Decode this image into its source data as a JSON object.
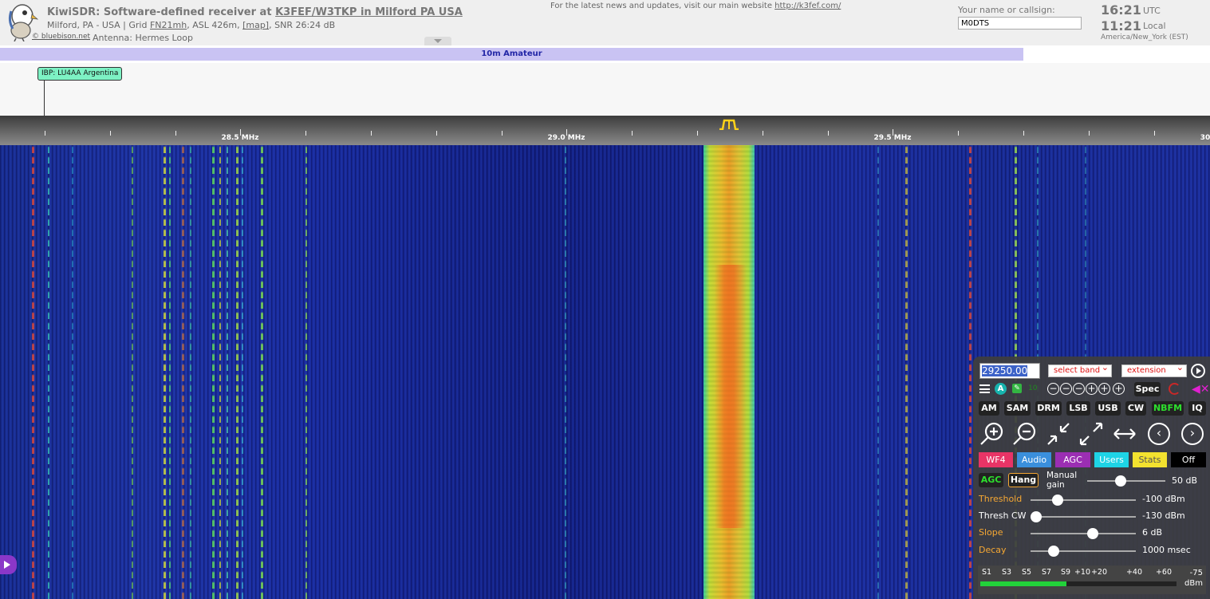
{
  "header": {
    "title_prefix": "KiwiSDR: Software-defined receiver at ",
    "title_station": "K3FEF/W3TKP in Milford PA USA",
    "location_text": "Milford, PA - USA | Grid ",
    "grid": "FN21mh",
    "asl": ", ASL 426m, ",
    "map_link": "[map]",
    "snr": ", SNR 26:24 dB",
    "credit": "© bluebison.net",
    "antenna": "Antenna: Hermes Loop",
    "news_text": "For the latest news and updates, visit our main website ",
    "news_link": "http://k3fef.com/",
    "callsign_label": "Your name or callsign:",
    "callsign_value": "M0DTS",
    "utc_time": "16:21",
    "utc_label": "UTC",
    "local_time": "11:21",
    "local_label": "Local",
    "timezone": "America/New_York (EST)"
  },
  "band": {
    "label": "10m Amateur",
    "color": "#c9c3f3"
  },
  "dx": {
    "label": "IBP: LU4AA Argentina",
    "color": "#7df2c4"
  },
  "scale": {
    "labels": [
      "28.5 MHz",
      "29.0 MHz",
      "29.5 MHz",
      "30"
    ]
  },
  "panel": {
    "frequency": "29250.00",
    "select_band": "select band",
    "select_extension": "extension",
    "step_value": "10",
    "step_buttons": [
      "−",
      "−",
      "−",
      "+",
      "+",
      "+"
    ],
    "spec_label": "Spec",
    "modes": [
      "AM",
      "SAM",
      "DRM",
      "LSB",
      "USB",
      "CW",
      "NBFM",
      "IQ"
    ],
    "active_mode": "NBFM",
    "zoom_icons": [
      "zoom-in-icon",
      "zoom-out-icon",
      "zoom-fit-icon",
      "zoom-max-icon",
      "swap-icon",
      "prev-icon",
      "next-icon"
    ],
    "tabs": [
      {
        "label": "WF4",
        "bg": "#e83466",
        "fg": "#ffffff"
      },
      {
        "label": "Audio",
        "bg": "#3a8fdc",
        "fg": "#ffffff"
      },
      {
        "label": "AGC",
        "bg": "#9b2eb3",
        "fg": "#ffffff"
      },
      {
        "label": "Users",
        "bg": "#1ed4e6",
        "fg": "#ffffff"
      },
      {
        "label": "Stats",
        "bg": "#f3e22f",
        "fg": "#555555"
      },
      {
        "label": "Off",
        "bg": "#000000",
        "fg": "#ffffff"
      }
    ],
    "agc_label": "AGC",
    "hang_label": "Hang",
    "manual_gain_label": "Manual gain",
    "manual_gain_value": "50 dB",
    "manual_gain_fraction": 0.43,
    "params": [
      {
        "label": "Threshold",
        "value": "-100 dBm",
        "fraction": 0.26,
        "color": "#f6a833"
      },
      {
        "label": "Thresh CW",
        "value": "-130 dBm",
        "fraction": 0.05,
        "color": "#ffffff"
      },
      {
        "label": "Slope",
        "value": "6 dB",
        "fraction": 0.59,
        "color": "#f6a833"
      },
      {
        "label": "Decay",
        "value": "1000 msec",
        "fraction": 0.22,
        "color": "#f6a833"
      }
    ],
    "smeter": {
      "labels": [
        "S1",
        "S3",
        "S5",
        "S7",
        "S9",
        "+10",
        "+20",
        "+40",
        "+60"
      ],
      "value_label": "-75",
      "unit": "dBm",
      "fraction": 0.44
    }
  }
}
